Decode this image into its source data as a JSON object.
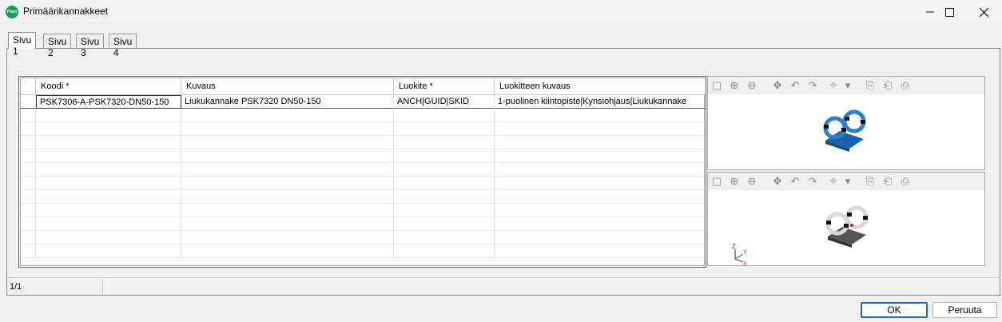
{
  "window": {
    "title": "Primäärikannakkeet",
    "icon_text": "Plant"
  },
  "tabs": [
    {
      "label": "Sivu 1",
      "active": true
    },
    {
      "label": "Sivu 2",
      "active": false
    },
    {
      "label": "Sivu 3",
      "active": false
    },
    {
      "label": "Sivu 4",
      "active": false
    }
  ],
  "table": {
    "columns": [
      "Koodi *",
      "Kuvaus",
      "Luokite *",
      "Luokitteen kuvaus"
    ],
    "rows": [
      [
        "PSK7306-A-PSK7320-DN50-150",
        "Liukukannake PSK7320 DN50-150",
        "ANCH|GUID|SKID",
        "1-puolinen kiintopiste|Kynsiohjaus|Liukukannake"
      ]
    ]
  },
  "status": {
    "page_counter": "1/1"
  },
  "buttons": {
    "ok": "OK",
    "cancel": "Peruuta"
  },
  "viewer": {
    "top_preview_color": "#2a7fd4",
    "bottom_preview_color": "#d8d8d8",
    "axes": {
      "x": "X",
      "y": "Y",
      "z": "Z"
    }
  }
}
